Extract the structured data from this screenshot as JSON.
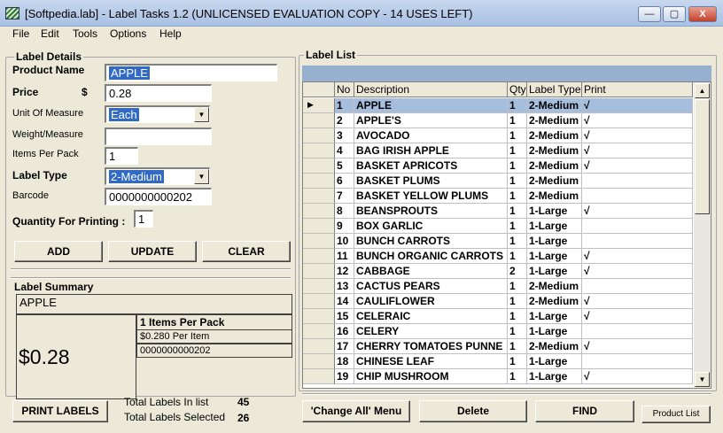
{
  "window": {
    "title": "[Softpedia.lab] - Label Tasks 1.2 (UNLICENSED EVALUATION COPY -  14 USES LEFT)",
    "minimize_glyph": "—",
    "maximize_glyph": "▢",
    "close_glyph": "X"
  },
  "menu": {
    "file": "File",
    "edit": "Edit",
    "tools": "Tools",
    "options": "Options",
    "help": "Help"
  },
  "label_details": {
    "title": "Label Details",
    "product_name_label": "Product Name",
    "product_name": "APPLE",
    "price_label": "Price",
    "currency_symbol": "$",
    "price": "0.28",
    "unit_of_measure_label": "Unit Of Measure",
    "unit_of_measure": "Each",
    "weight_measure_label": "Weight/Measure",
    "weight_measure": "",
    "items_per_pack_label": "Items Per Pack",
    "items_per_pack": "1",
    "label_type_label": "Label Type",
    "label_type": "2-Medium",
    "barcode_label": "Barcode",
    "barcode": "0000000000202",
    "quantity_label": "Quantity For Printing :",
    "quantity": "1"
  },
  "actions": {
    "add": "ADD",
    "update": "UPDATE",
    "clear": "CLEAR"
  },
  "label_summary": {
    "title": "Label Summary",
    "name": "APPLE",
    "items_per_pack": "1 Items Per Pack",
    "per_item": "$0.280 Per Item",
    "barcode": "0000000000202",
    "price": "$0.28"
  },
  "footer_left": {
    "print_labels": "PRINT LABELS",
    "total_in_list_label": "Total Labels In list",
    "total_in_list": "45",
    "total_selected_label": "Total Labels Selected",
    "total_selected": "26"
  },
  "label_list": {
    "title": "Label List",
    "columns": {
      "no": "No",
      "description": "Description",
      "qty": "Qty",
      "label_type": "Label Type",
      "print": "Print"
    },
    "current_row_marker": "▶",
    "scroll_up": "▲",
    "scroll_down": "▼",
    "rows": [
      {
        "no": "1",
        "description": "APPLE",
        "qty": "1",
        "type": "2-Medium",
        "print": "√"
      },
      {
        "no": "2",
        "description": "APPLE'S",
        "qty": "1",
        "type": "2-Medium",
        "print": "√"
      },
      {
        "no": "3",
        "description": "AVOCADO",
        "qty": "1",
        "type": "2-Medium",
        "print": "√"
      },
      {
        "no": "4",
        "description": "BAG IRISH APPLE",
        "qty": "1",
        "type": "2-Medium",
        "print": "√"
      },
      {
        "no": "5",
        "description": "BASKET APRICOTS",
        "qty": "1",
        "type": "2-Medium",
        "print": "√"
      },
      {
        "no": "6",
        "description": "BASKET PLUMS",
        "qty": "1",
        "type": "2-Medium",
        "print": ""
      },
      {
        "no": "7",
        "description": "BASKET YELLOW PLUMS",
        "qty": "1",
        "type": "2-Medium",
        "print": ""
      },
      {
        "no": "8",
        "description": "BEANSPROUTS",
        "qty": "1",
        "type": "1-Large",
        "print": "√"
      },
      {
        "no": "9",
        "description": "BOX GARLIC",
        "qty": "1",
        "type": "1-Large",
        "print": ""
      },
      {
        "no": "10",
        "description": "BUNCH CARROTS",
        "qty": "1",
        "type": "1-Large",
        "print": ""
      },
      {
        "no": "11",
        "description": "BUNCH ORGANIC CARROTS",
        "qty": "1",
        "type": "1-Large",
        "print": "√"
      },
      {
        "no": "12",
        "description": "CABBAGE",
        "qty": "2",
        "type": "1-Large",
        "print": "√"
      },
      {
        "no": "13",
        "description": "CACTUS PEARS",
        "qty": "1",
        "type": "2-Medium",
        "print": ""
      },
      {
        "no": "14",
        "description": "CAULIFLOWER",
        "qty": "1",
        "type": "2-Medium",
        "print": "√"
      },
      {
        "no": "15",
        "description": "CELERAIC",
        "qty": "1",
        "type": "1-Large",
        "print": "√"
      },
      {
        "no": "16",
        "description": "CELERY",
        "qty": "1",
        "type": "1-Large",
        "print": ""
      },
      {
        "no": "17",
        "description": "CHERRY TOMATOES PUNNE",
        "qty": "1",
        "type": "2-Medium",
        "print": "√"
      },
      {
        "no": "18",
        "description": "CHINESE LEAF",
        "qty": "1",
        "type": "1-Large",
        "print": ""
      },
      {
        "no": "19",
        "description": "CHIP MUSHROOM",
        "qty": "1",
        "type": "1-Large",
        "print": "√"
      }
    ]
  },
  "footer_right": {
    "change_all_menu": "'Change All' Menu",
    "delete": "Delete",
    "find": "FIND",
    "product_list": "Product List"
  }
}
